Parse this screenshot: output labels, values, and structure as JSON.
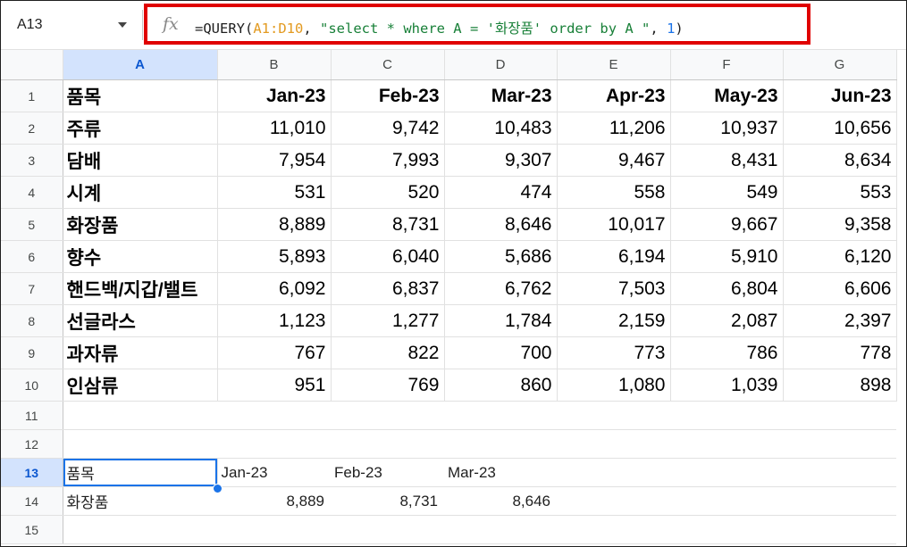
{
  "name_box": "A13",
  "formula": {
    "prefix": "=QUERY(",
    "range": "A1:D10",
    "sep1": ", ",
    "query_string": "\"select * where A = '화장품' order by A \"",
    "sep2": ", ",
    "headers_arg": "1",
    "suffix": ")"
  },
  "colors": {
    "highlight_box": "#e00000",
    "selection": "#1a73e8",
    "range_token": "#e39b22",
    "string_token": "#188038",
    "number_token": "#1a73e8"
  },
  "column_headers": [
    "A",
    "B",
    "C",
    "D",
    "E",
    "F",
    "G"
  ],
  "row_numbers": [
    "1",
    "2",
    "3",
    "4",
    "5",
    "6",
    "7",
    "8",
    "9",
    "10",
    "11",
    "12",
    "13",
    "14",
    "15"
  ],
  "table": {
    "header": [
      "품목",
      "Jan-23",
      "Feb-23",
      "Mar-23",
      "Apr-23",
      "May-23",
      "Jun-23"
    ],
    "rows": [
      [
        "주류",
        "11,010",
        "9,742",
        "10,483",
        "11,206",
        "10,937",
        "10,656"
      ],
      [
        "담배",
        "7,954",
        "7,993",
        "9,307",
        "9,467",
        "8,431",
        "8,634"
      ],
      [
        "시계",
        "531",
        "520",
        "474",
        "558",
        "549",
        "553"
      ],
      [
        "화장품",
        "8,889",
        "8,731",
        "8,646",
        "10,017",
        "9,667",
        "9,358"
      ],
      [
        "향수",
        "5,893",
        "6,040",
        "5,686",
        "6,194",
        "5,910",
        "6,120"
      ],
      [
        "핸드백/지갑/밸트",
        "6,092",
        "6,837",
        "6,762",
        "7,503",
        "6,804",
        "6,606"
      ],
      [
        "선글라스",
        "1,123",
        "1,277",
        "1,784",
        "2,159",
        "2,087",
        "2,397"
      ],
      [
        "과자류",
        "767",
        "822",
        "700",
        "773",
        "786",
        "778"
      ],
      [
        "인삼류",
        "951",
        "769",
        "860",
        "1,080",
        "1,039",
        "898"
      ]
    ]
  },
  "query_result": {
    "header": [
      "품목",
      "Jan-23",
      "Feb-23",
      "Mar-23"
    ],
    "row": [
      "화장품",
      "8,889",
      "8,731",
      "8,646"
    ]
  }
}
